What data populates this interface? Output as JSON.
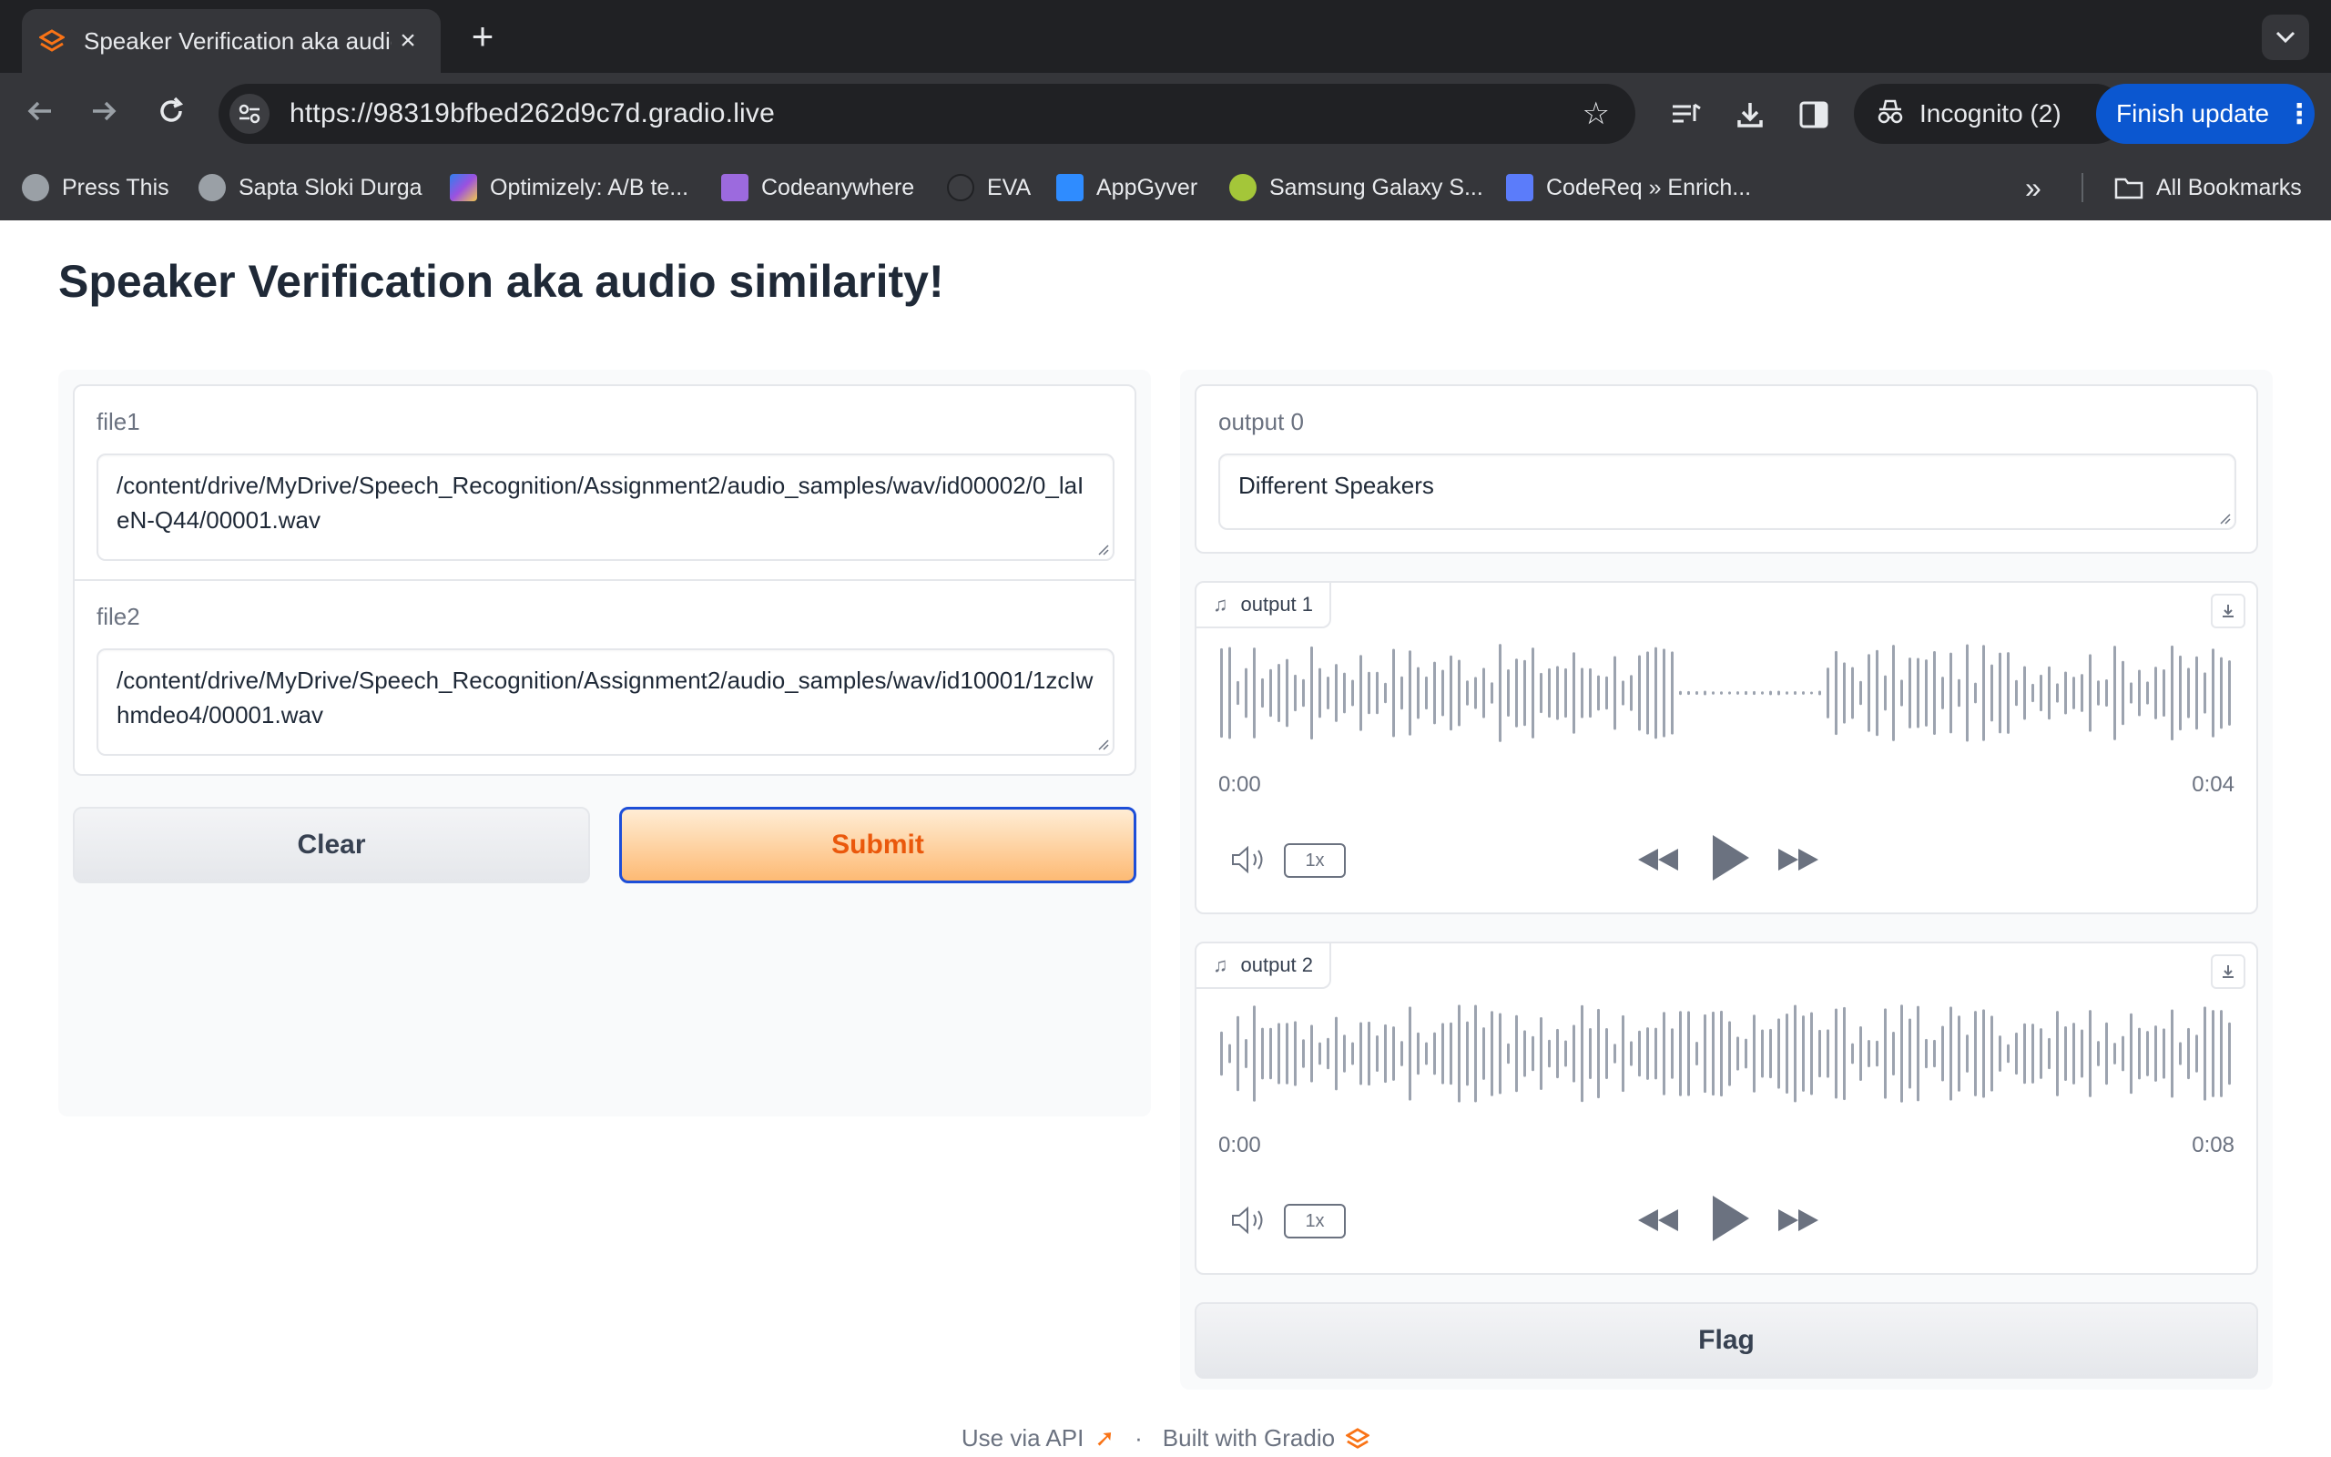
{
  "browser": {
    "tab_title": "Speaker Verification aka audio",
    "url": "https://98319bfbed262d9c7d.gradio.live",
    "incognito_label": "Incognito (2)",
    "finish_update_label": "Finish update",
    "bookmarks": [
      {
        "label": "Press This",
        "icon": "globe-icon",
        "color": "#9aa0a6"
      },
      {
        "label": "Sapta Sloki Durga",
        "icon": "globe-icon",
        "color": "#9aa0a6"
      },
      {
        "label": "Optimizely: A/B te...",
        "icon": "optimizely-icon",
        "color": "#7c4dff"
      },
      {
        "label": "Codeanywhere",
        "icon": "cube-icon",
        "color": "#9c6ade"
      },
      {
        "label": "EVA",
        "icon": "github-icon",
        "color": "#3c3d41"
      },
      {
        "label": "AppGyver",
        "icon": "appgyver-icon",
        "color": "#2f8cff"
      },
      {
        "label": "Samsung Galaxy S...",
        "icon": "android-icon",
        "color": "#a4c639"
      },
      {
        "label": "CodeReq » Enrich...",
        "icon": "hd-icon",
        "color": "#5b7cfa"
      }
    ],
    "all_bookmarks_label": "All Bookmarks"
  },
  "app": {
    "title": "Speaker Verification aka audio similarity!",
    "inputs": {
      "file1": {
        "label": "file1",
        "value": "/content/drive/MyDrive/Speech_Recognition/Assignment2/audio_samples/wav/id00002/0_laIeN-Q44/00001.wav"
      },
      "file2": {
        "label": "file2",
        "value": "/content/drive/MyDrive/Speech_Recognition/Assignment2/audio_samples/wav/id10001/1zcIwhmdeo4/00001.wav"
      }
    },
    "buttons": {
      "clear": "Clear",
      "submit": "Submit",
      "flag": "Flag"
    },
    "outputs": {
      "output0": {
        "label": "output 0",
        "value": "Different Speakers"
      },
      "output1": {
        "label": "output 1",
        "time_start": "0:00",
        "time_end": "0:04",
        "speed": "1x"
      },
      "output2": {
        "label": "output 2",
        "time_start": "0:00",
        "time_end": "0:08",
        "speed": "1x"
      }
    },
    "footer": {
      "api_label": "Use via API",
      "separator": "·",
      "built_label": "Built with Gradio"
    },
    "colors": {
      "accent_orange": "#ea580c",
      "submit_border": "#1d4ed8",
      "waveform": "#9ca3af",
      "chrome_dark": "#202124",
      "update_blue": "#0b57d0"
    }
  }
}
